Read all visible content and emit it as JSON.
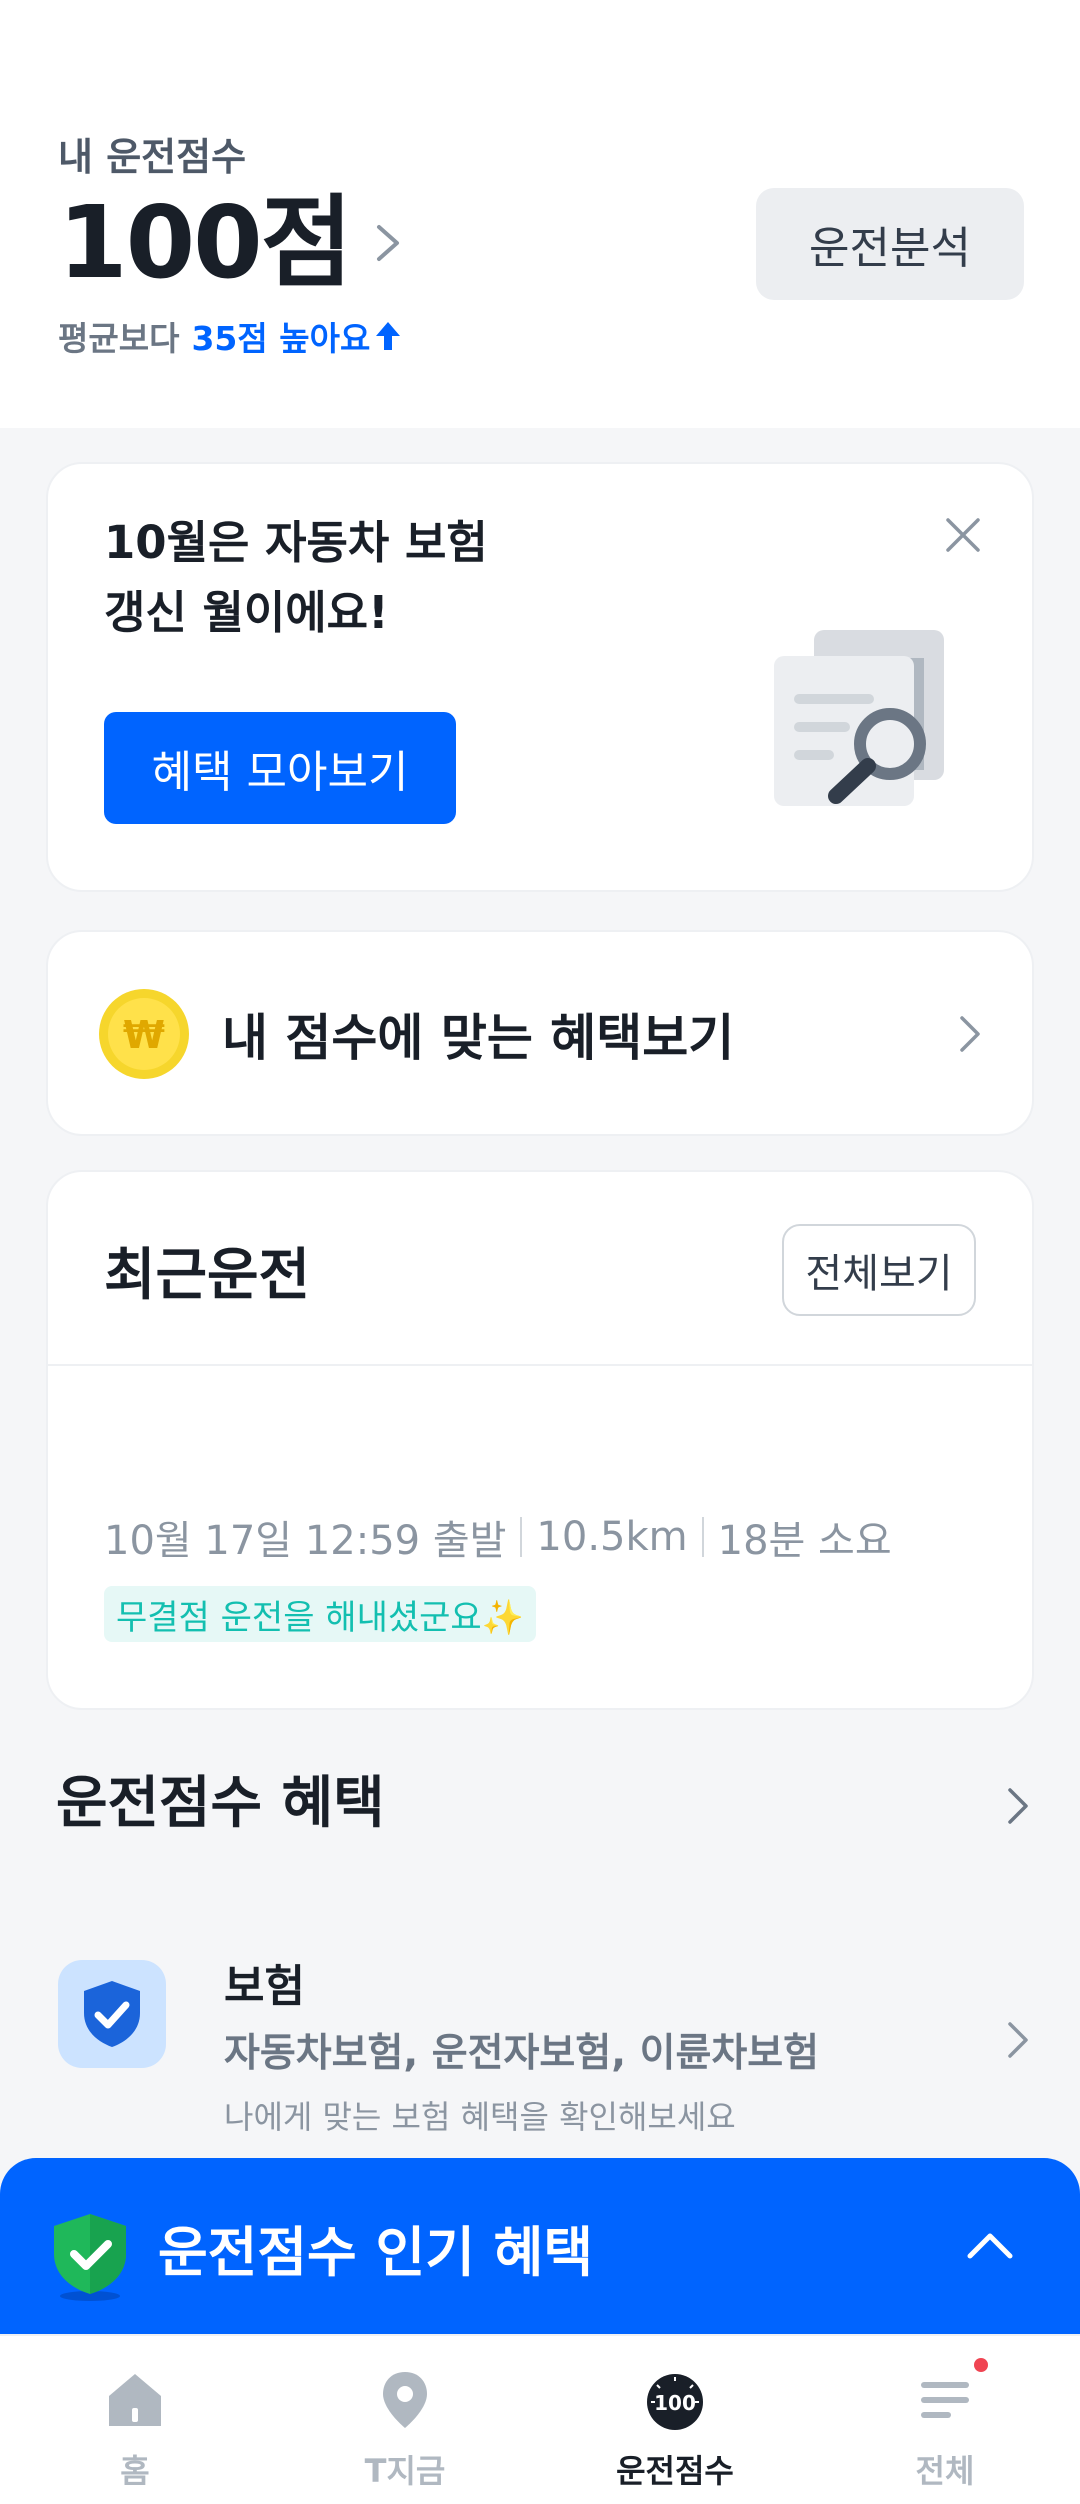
{
  "header": {
    "score_label": "내 운전점수",
    "score_value": "100점",
    "compare_prefix": "평균보다",
    "compare_highlight": "35점 높아요",
    "analysis_button": "운전분석"
  },
  "promo": {
    "title_line1": "10월은 자동차 보험",
    "title_line2": "갱신 월이에요!",
    "button": "혜택 모아보기"
  },
  "benefit_row": {
    "coin_symbol": "₩",
    "label": "내 점수에 맞는 혜택보기"
  },
  "recent": {
    "title": "최근운전",
    "view_all": "전체보기",
    "trip_departure": "10월 17일 12:59 출발",
    "trip_distance": "10.5km",
    "trip_duration": "18분 소요",
    "badge": "무결점 운전을 해내셨군요✨"
  },
  "benefits_section": {
    "title": "운전점수 혜택",
    "item": {
      "title": "보험",
      "subtitle": "자동차보험, 운전자보험, 이륜차보험",
      "description": "나에게 맞는 보험 혜택을 확인해보세요"
    }
  },
  "popular": {
    "title": "운전점수 인기 혜택"
  },
  "tabbar": {
    "tabs": [
      {
        "label": "홈",
        "icon": "home-icon",
        "active": false
      },
      {
        "label": "T지금",
        "icon": "location-pin-icon",
        "active": false
      },
      {
        "label": "운전점수",
        "icon": "score-gauge-icon",
        "badge": "100",
        "active": true
      },
      {
        "label": "전체",
        "icon": "menu-icon",
        "active": false
      }
    ]
  },
  "colors": {
    "primary": "#0064ff",
    "background": "#f5f6f8",
    "badge_text": "#13bfb0",
    "notification_dot": "#f04452"
  }
}
